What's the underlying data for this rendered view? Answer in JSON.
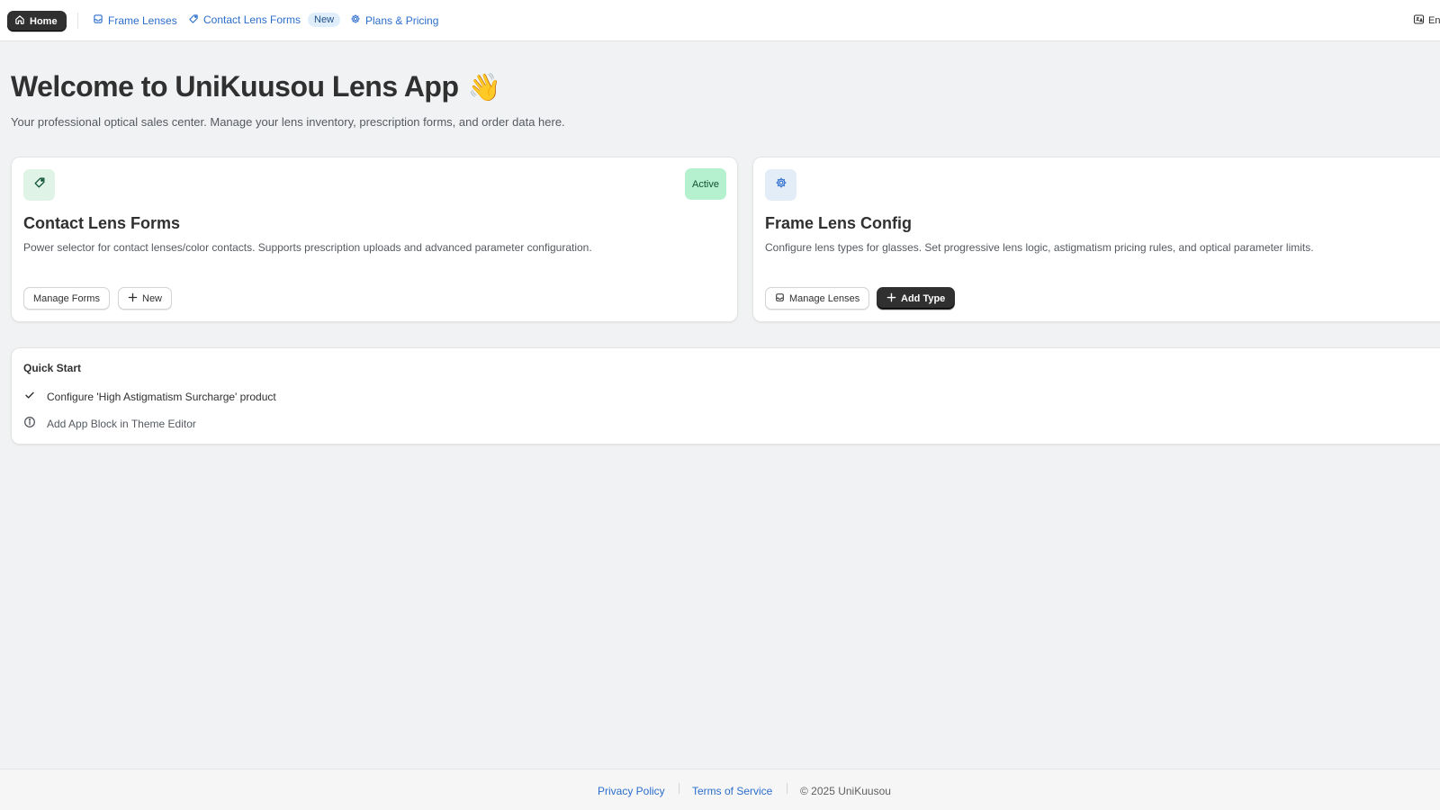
{
  "topnav": {
    "home": {
      "label": "Home",
      "icon": "home-icon"
    },
    "links": [
      {
        "label": "Frame Lenses",
        "icon": "inbox-icon"
      },
      {
        "label": "Contact Lens Forms",
        "icon": "tag-icon",
        "badge": "New"
      },
      {
        "label": "Plans & Pricing",
        "icon": "gear-icon"
      }
    ],
    "language": {
      "label": "En",
      "icon": "language-icon"
    }
  },
  "header": {
    "title": "Welcome to UniKuusou Lens App",
    "emoji": "👋",
    "subtitle": "Your professional optical sales center. Manage your lens inventory, prescription forms, and order data here."
  },
  "cards": [
    {
      "icon": "tag-icon",
      "icon_bg": "#dff3e6",
      "badge": "Active",
      "title": "Contact Lens Forms",
      "description": "Power selector for contact lenses/color contacts. Supports prescription uploads and advanced parameter configuration.",
      "buttons": [
        {
          "label": "Manage Forms",
          "style": "secondary"
        },
        {
          "label": "New",
          "style": "secondary",
          "icon": "plus-icon"
        }
      ]
    },
    {
      "icon": "gear-icon",
      "icon_bg": "#e3edf8",
      "title": "Frame Lens Config",
      "description": "Configure lens types for glasses. Set progressive lens logic, astigmatism pricing rules, and optical parameter limits.",
      "buttons": [
        {
          "label": "Manage Lenses",
          "style": "secondary",
          "icon": "inbox-icon"
        },
        {
          "label": "Add Type",
          "style": "primary",
          "icon": "plus-icon"
        }
      ]
    }
  ],
  "quick_start": {
    "title": "Quick Start",
    "items": [
      {
        "label": "Configure 'High Astigmatism Surcharge' product",
        "status": "done",
        "icon": "check-icon"
      },
      {
        "label": "Add App Block in Theme Editor",
        "status": "pending",
        "icon": "info-icon"
      }
    ]
  },
  "footer": {
    "privacy": "Privacy Policy",
    "terms": "Terms of Service",
    "copyright": "© 2025 UniKuusou"
  },
  "colors": {
    "link": "#2c6ecb",
    "primary_button": "#303030",
    "active_badge_bg": "#b5f0cf",
    "background": "#f1f2f3"
  }
}
